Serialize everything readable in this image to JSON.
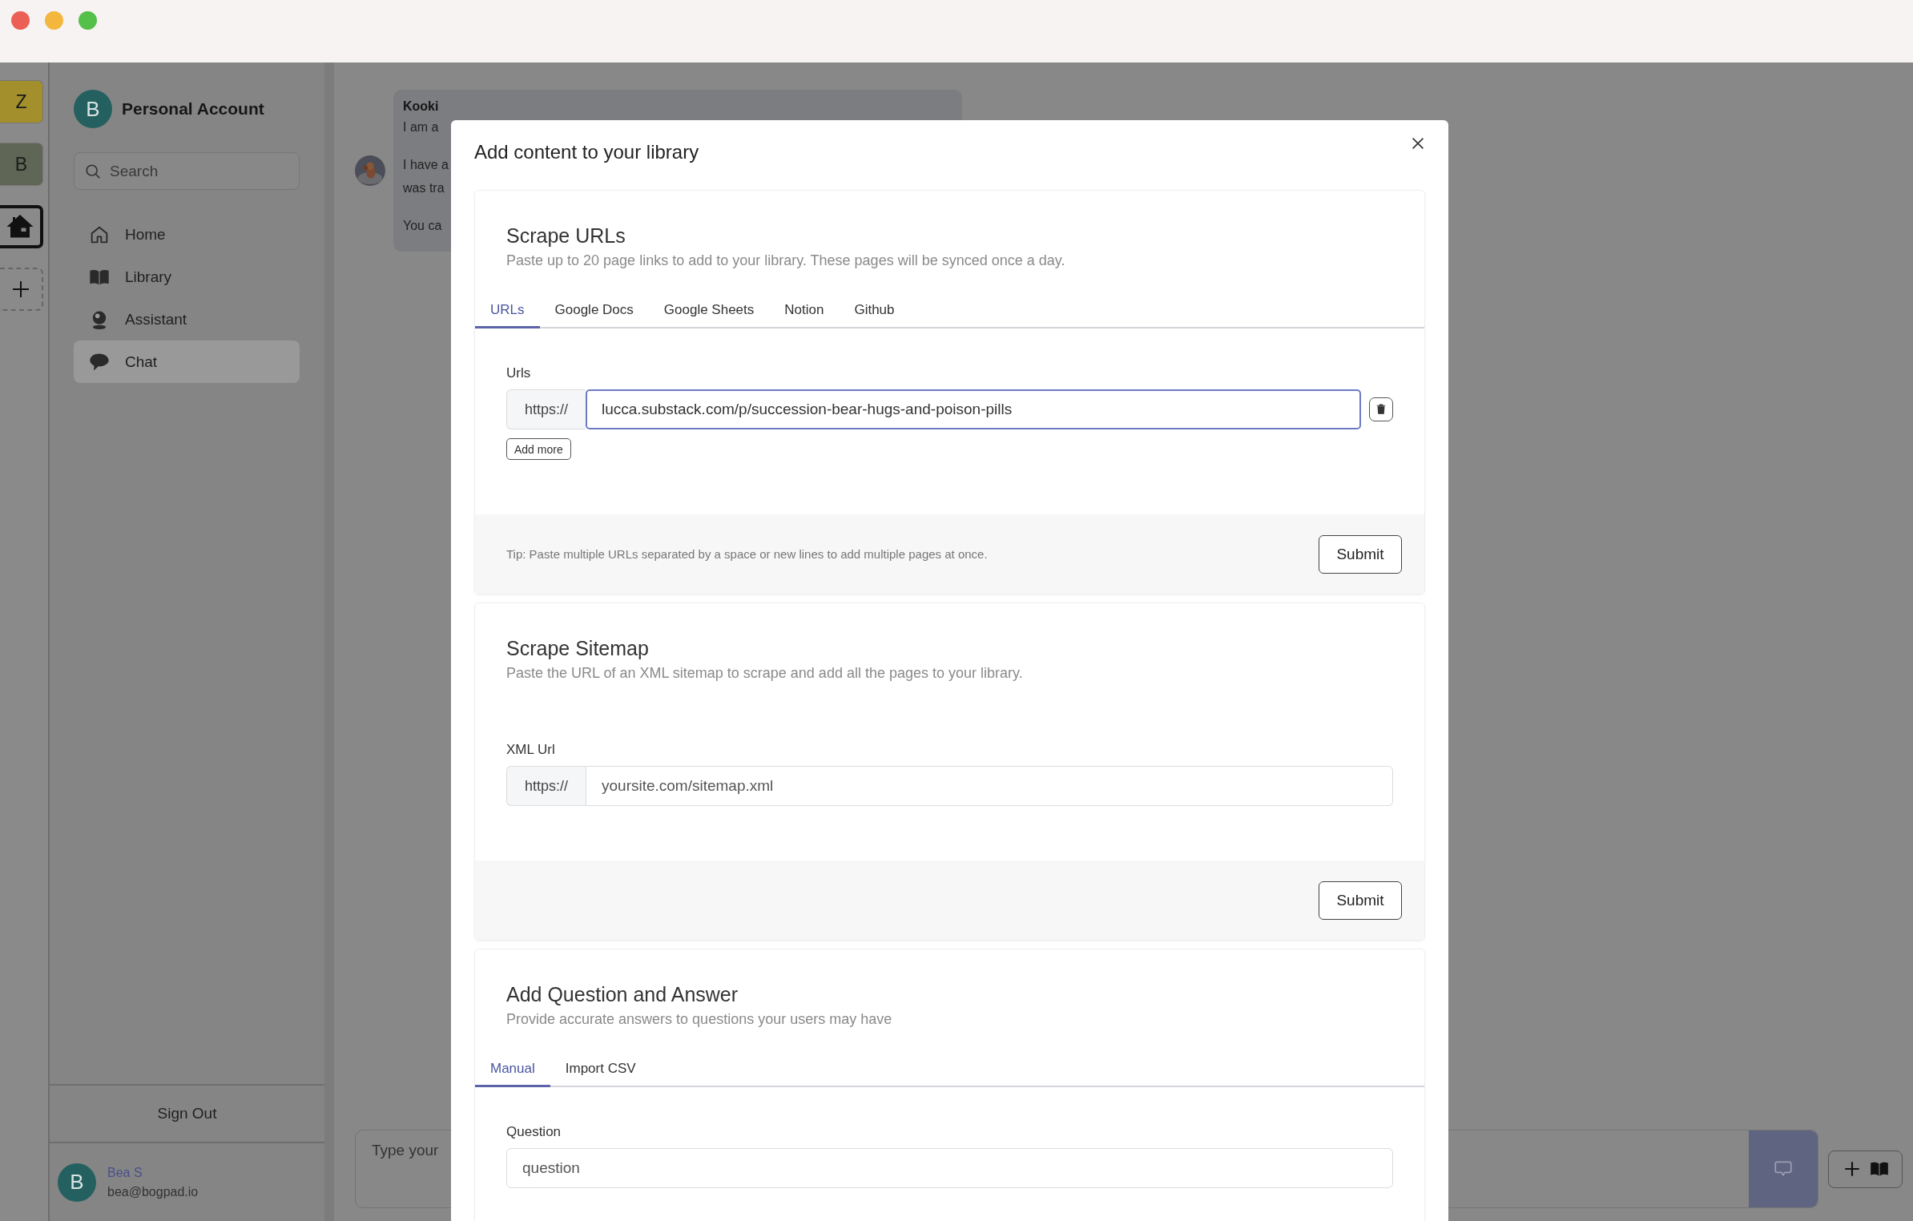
{
  "rail": {
    "items": [
      {
        "kind": "letter",
        "label": "Z",
        "color": "#a38f2c",
        "selected": false
      },
      {
        "kind": "letter",
        "label": "B",
        "color": "#5f6655",
        "selected": false
      },
      {
        "kind": "home",
        "selected": true
      },
      {
        "kind": "add",
        "selected": false
      }
    ]
  },
  "sidebar": {
    "account": {
      "avatar": "B",
      "name": "Personal Account"
    },
    "search": {
      "placeholder": "Search"
    },
    "nav": [
      {
        "label": "Home",
        "selected": false
      },
      {
        "label": "Library",
        "selected": false
      },
      {
        "label": "Assistant",
        "selected": false
      },
      {
        "label": "Chat",
        "selected": true
      }
    ],
    "sign_out": "Sign Out",
    "user": {
      "avatar": "B",
      "name": "Bea S",
      "email": "bea@bogpad.io"
    }
  },
  "chat": {
    "messages": [
      {
        "author": "Kooki",
        "paragraphs": [
          [
            "I am a"
          ],
          [
            "I have a",
            "was tra"
          ],
          [
            "You ca"
          ]
        ]
      }
    ],
    "composer": {
      "placeholder": "Type your"
    }
  },
  "modal": {
    "title": "Add content to your library",
    "sections": [
      {
        "title": "Scrape URLs",
        "description": "Paste up to 20 page links to add to your library. These pages will be synced once a day.",
        "tabs": [
          {
            "label": "URLs",
            "selected": true
          },
          {
            "label": "Google Docs",
            "selected": false
          },
          {
            "label": "Google Sheets",
            "selected": false
          },
          {
            "label": "Notion",
            "selected": false
          },
          {
            "label": "Github",
            "selected": false
          }
        ],
        "field": {
          "label": "Urls",
          "prefix": "https://",
          "value": "lucca.substack.com/p/succession-bear-hugs-and-poison-pills",
          "focused": true,
          "removable": true
        },
        "add_more": "Add more",
        "footer": {
          "tip": "Tip: Paste multiple URLs separated by a space or new lines to add multiple pages at once.",
          "submit": "Submit"
        }
      },
      {
        "title": "Scrape Sitemap",
        "description": "Paste the URL of an XML sitemap to scrape and add all the pages to your library.",
        "field": {
          "label": "XML Url",
          "prefix": "https://",
          "placeholder": "yoursite.com/sitemap.xml",
          "focused": false
        },
        "footer": {
          "submit": "Submit"
        }
      },
      {
        "title": "Add Question and Answer",
        "description": "Provide accurate answers to questions your users may have",
        "tabs": [
          {
            "label": "Manual",
            "selected": true
          },
          {
            "label": "Import CSV",
            "selected": false
          }
        ],
        "field": {
          "label": "Question",
          "placeholder": "question",
          "focused": false
        }
      }
    ]
  }
}
